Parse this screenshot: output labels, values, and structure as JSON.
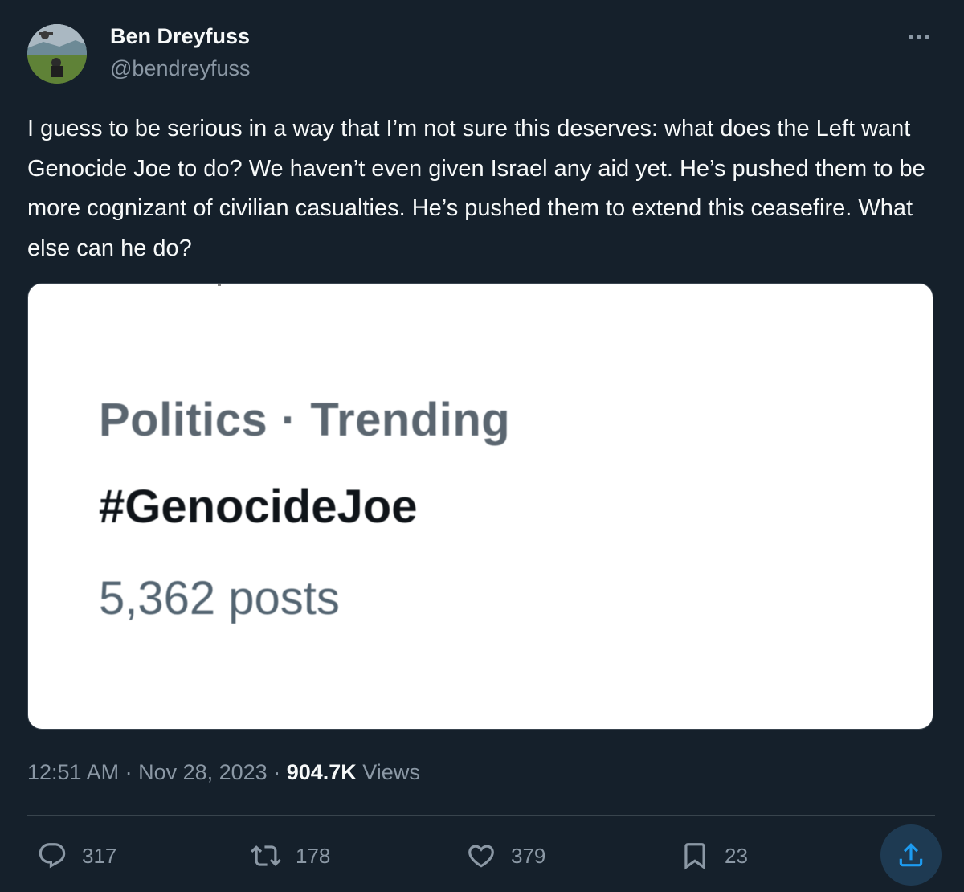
{
  "author": {
    "name": "Ben Dreyfuss",
    "handle": "@bendreyfuss"
  },
  "tweet": {
    "text": "I guess to be serious in a way that I’m not sure this deserves: what does the Left want Genocide Joe to do? We haven’t even given Israel any aid yet. He’s pushed them to be more cognizant of civilian casualties. He’s pushed them to extend this ceasefire. What else can he do?"
  },
  "media": {
    "category": "Politics · Trending",
    "trend": "#GenocideJoe",
    "post_count": "5,362 posts"
  },
  "meta": {
    "time": "12:51 AM",
    "sep1": " · ",
    "date": "Nov 28, 2023",
    "sep2": " · ",
    "views": "904.7K",
    "views_label": " Views"
  },
  "actions": {
    "replies": "317",
    "reposts": "178",
    "likes": "379",
    "bookmarks": "23"
  },
  "icons": {
    "more": "more-icon",
    "reply": "reply-icon",
    "repost": "repost-icon",
    "like": "heart-icon",
    "bookmark": "bookmark-icon",
    "share": "share-icon"
  },
  "colors": {
    "background": "#15202b",
    "text": "#f7f9f9",
    "secondary": "#8b98a5",
    "accent": "#1d9bf0"
  }
}
